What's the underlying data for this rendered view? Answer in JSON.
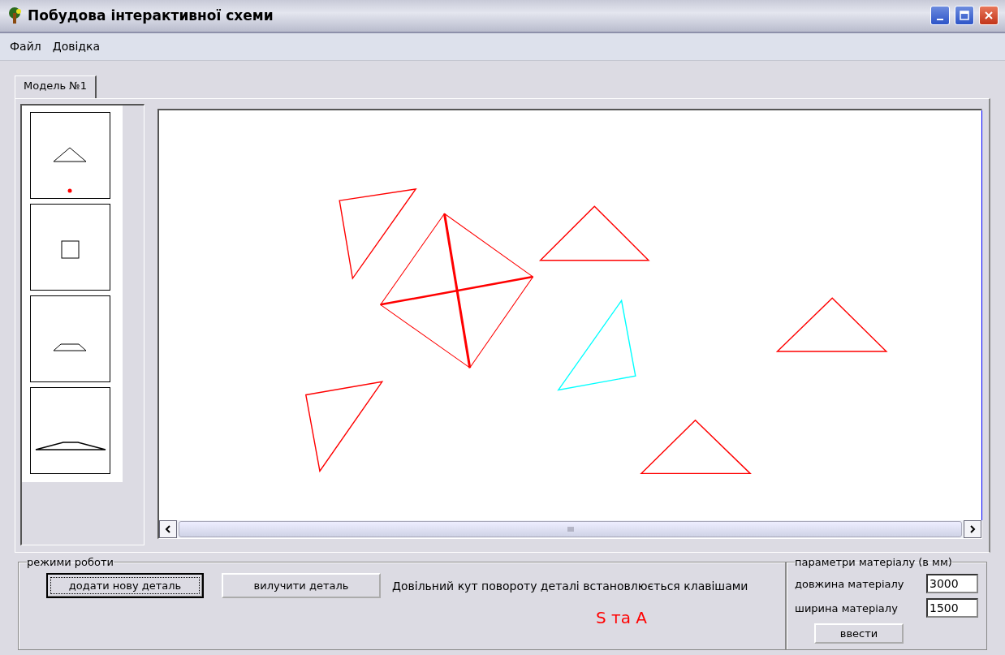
{
  "window": {
    "title": "Побудова інтерактивної схеми"
  },
  "menu": [
    "Файл",
    "Довідка"
  ],
  "tabs": [
    {
      "label": "Модель №1",
      "selected": true
    }
  ],
  "palette": [
    {
      "kind": "triangle",
      "selected": true
    },
    {
      "kind": "square",
      "selected": false
    },
    {
      "kind": "trapezoid",
      "selected": false
    },
    {
      "kind": "wide-trapezoid",
      "selected": false
    }
  ],
  "canvas": {
    "shapes": [
      {
        "kind": "triangle",
        "color": "#ff0000"
      },
      {
        "kind": "square-cross",
        "color": "#ff0000"
      },
      {
        "kind": "triangle",
        "color": "#ff0000"
      },
      {
        "kind": "triangle",
        "color": "#00ffff"
      },
      {
        "kind": "triangle",
        "color": "#ff0000"
      },
      {
        "kind": "triangle",
        "color": "#ff0000"
      },
      {
        "kind": "triangle",
        "color": "#ff0000"
      }
    ]
  },
  "modes": {
    "legend": "режими роботи",
    "buttons": [
      {
        "label": "додати нову деталь",
        "focused": true
      },
      {
        "label": "вилучити деталь",
        "focused": false
      }
    ],
    "hint": "Довільний кут повороту деталі встановлюється клавішами",
    "keys": "S та A"
  },
  "material": {
    "legend": "параметри матеріалу (в мм)",
    "fields": [
      {
        "label": "довжина матеріалу",
        "value": "3000"
      },
      {
        "label": "ширина матеріалу",
        "value": "1500"
      }
    ],
    "button": "ввести"
  }
}
